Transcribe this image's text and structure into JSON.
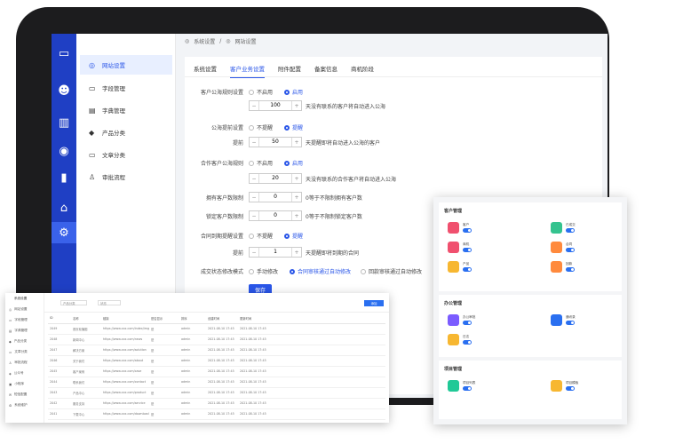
{
  "breadcrumb": {
    "root": "系统设置",
    "sep": "/",
    "current": "网站设置"
  },
  "sidemenu": [
    {
      "label": "网站设置",
      "icon": "globe-icon"
    },
    {
      "label": "字段管理",
      "icon": "folder-icon"
    },
    {
      "label": "字典管理",
      "icon": "book-icon"
    },
    {
      "label": "产品分类",
      "icon": "layers-icon"
    },
    {
      "label": "文章分类",
      "icon": "folder-icon"
    },
    {
      "label": "审批流程",
      "icon": "user-icon"
    }
  ],
  "tabs": [
    "系统设置",
    "客户业务设置",
    "附件配置",
    "备案信息",
    "商机阶段"
  ],
  "active_tab": "客户业务设置",
  "form": {
    "pool_rule_label": "客户公海规则设置",
    "pool_rule_off": "不启用",
    "pool_rule_on": "启用",
    "pool_days": "100",
    "pool_days_hint": "天没有联系的客户将自动进入公海",
    "remind_label": "公海提前设置",
    "remind_off": "不提醒",
    "remind_on": "提醒",
    "advance_label": "提前",
    "advance_days": "50",
    "advance_hint": "天提醒即将自动进入公海的客户",
    "coop_label": "合作客户公海规则",
    "coop_off": "不启用",
    "coop_on": "启用",
    "coop_days": "20",
    "coop_hint": "天没有联系的合作客户将自动进入公海",
    "own_limit_label": "拥有客户数限制",
    "own_limit_value": "0",
    "own_limit_hint": "0等于不限制拥有客户数",
    "lock_limit_label": "锁定客户数限制",
    "lock_limit_value": "0",
    "lock_limit_hint": "0等于不限制锁定客户数",
    "contract_label": "合同到期提醒设置",
    "contract_off": "不提醒",
    "contract_on": "提醒",
    "contract_advance_label": "提前",
    "contract_days": "1",
    "contract_hint": "天提醒即将到期的合同",
    "status_label": "成交状态修改模式",
    "status_opt1": "手动修改",
    "status_opt2": "合同审核通过自动修改",
    "status_opt3": "回款审核通过自动修改",
    "save": "保存"
  },
  "table_window": {
    "title": "系统设置",
    "menu": [
      "网站设置",
      "字段管理",
      "字典管理",
      "产品分类",
      "文章分类",
      "审批流程",
      "公众号",
      "小程序",
      "短信配置",
      "系统维护"
    ],
    "filters": [
      "产品分类",
      "状态"
    ],
    "add_button": "添加",
    "columns": [
      "ID",
      "名称",
      "链接",
      "是否显示",
      "排序",
      "创建时间",
      "更新时间"
    ],
    "rows": [
      {
        "id": "2049",
        "name": "首页轮播图",
        "link": "https://www.xxx.com/index/img",
        "show": "是",
        "sort": "admin",
        "created": "2021-08-10 17:45",
        "updated": "2021-08-10 17:45"
      },
      {
        "id": "2048",
        "name": "新闻中心",
        "link": "https://www.xxx.com/news",
        "show": "是",
        "sort": "admin",
        "created": "2021-08-10 17:45",
        "updated": "2021-08-10 17:45"
      },
      {
        "id": "2047",
        "name": "解决方案",
        "link": "https://www.xxx.com/solution",
        "show": "是",
        "sort": "admin",
        "created": "2021-08-10 17:45",
        "updated": "2021-08-10 17:45"
      },
      {
        "id": "2046",
        "name": "关于我们",
        "link": "https://www.xxx.com/about",
        "show": "是",
        "sort": "admin",
        "created": "2021-08-10 17:45",
        "updated": "2021-08-10 17:45"
      },
      {
        "id": "2045",
        "name": "客户案例",
        "link": "https://www.xxx.com/case",
        "show": "是",
        "sort": "admin",
        "created": "2021-08-10 17:45",
        "updated": "2021-08-10 17:45"
      },
      {
        "id": "2044",
        "name": "联系我们",
        "link": "https://www.xxx.com/contact",
        "show": "是",
        "sort": "admin",
        "created": "2021-08-10 17:45",
        "updated": "2021-08-10 17:45"
      },
      {
        "id": "2043",
        "name": "产品中心",
        "link": "https://www.xxx.com/product",
        "show": "是",
        "sort": "admin",
        "created": "2021-08-10 17:45",
        "updated": "2021-08-10 17:45"
      },
      {
        "id": "2042",
        "name": "服务支持",
        "link": "https://www.xxx.com/service",
        "show": "是",
        "sort": "admin",
        "created": "2021-08-10 17:45",
        "updated": "2021-08-10 17:45"
      },
      {
        "id": "2041",
        "name": "下载中心",
        "link": "https://www.xxx.com/download",
        "show": "是",
        "sort": "admin",
        "created": "2021-08-10 17:45",
        "updated": "2021-08-10 17:45"
      }
    ]
  },
  "perm_window": {
    "sections": [
      {
        "title": "客户管理",
        "items": [
          {
            "label": "客户",
            "color": "#f0506e"
          },
          {
            "label": "已成交",
            "color": "#34c38f"
          },
          {
            "label": "商机",
            "color": "#f0506e"
          },
          {
            "label": "合同",
            "color": "#ff8a3d"
          },
          {
            "label": "产品",
            "color": "#f7b731"
          },
          {
            "label": "回款",
            "color": "#ff8a3d"
          }
        ]
      },
      {
        "title": "办公管理",
        "items": [
          {
            "label": "办公审批",
            "color": "#7b5cff"
          },
          {
            "label": "通讯录",
            "color": "#2a6ff0"
          },
          {
            "label": "日志",
            "color": "#f7b731"
          }
        ]
      },
      {
        "title": "项目管理",
        "items": [
          {
            "label": "项目列表",
            "color": "#20c997"
          },
          {
            "label": "项目模板",
            "color": "#f7b731"
          }
        ]
      }
    ]
  }
}
